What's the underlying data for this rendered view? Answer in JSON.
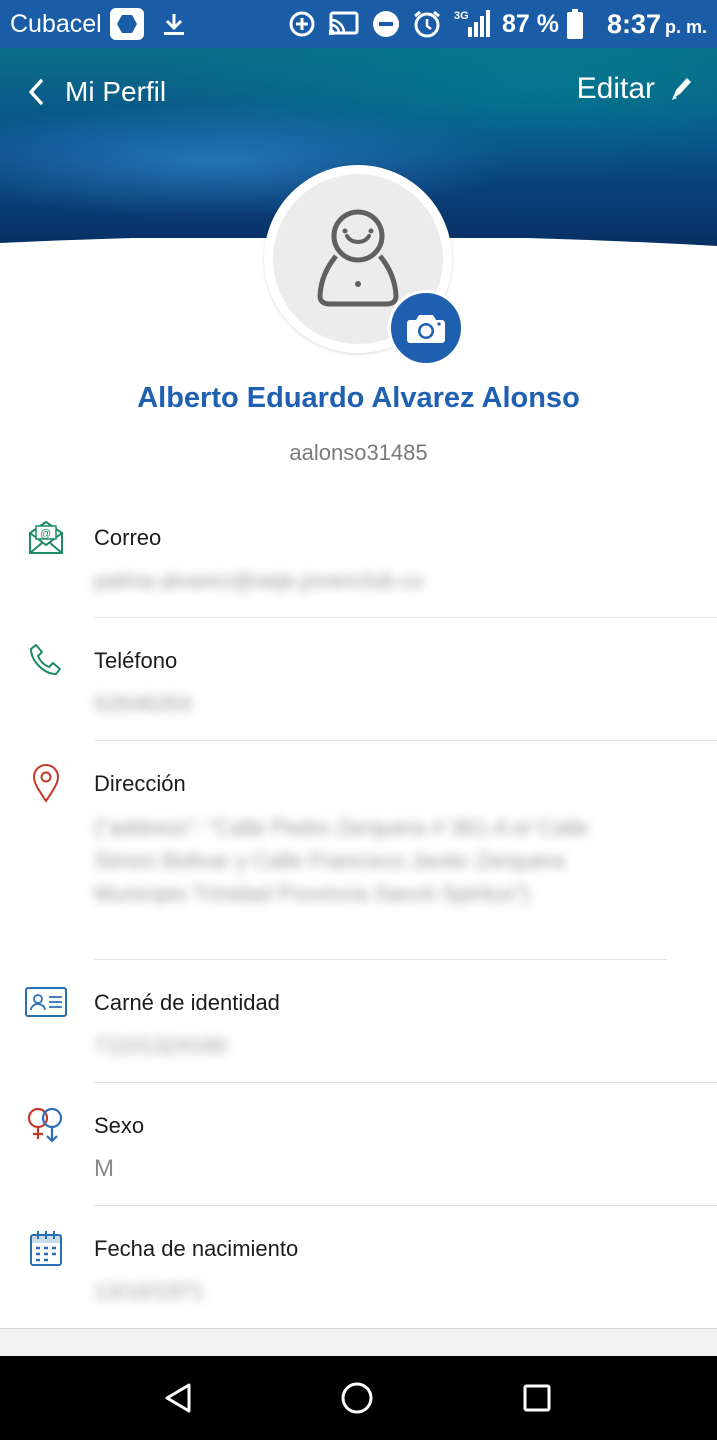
{
  "status_bar": {
    "carrier": "Cubacel",
    "network": "3G",
    "battery": "87 %",
    "time": "8:37",
    "ampm": "p. m."
  },
  "header": {
    "title": "Mi Perfil",
    "edit_label": "Editar"
  },
  "profile": {
    "name": "Alberto Eduardo Alvarez Alonso",
    "username": "aalonso31485"
  },
  "fields": {
    "email": {
      "label": "Correo",
      "value": "palma.alvarez@oeje.jovenclub.cu",
      "icon": "email-icon"
    },
    "phone": {
      "label": "Teléfono",
      "value": "52646264",
      "icon": "phone-icon"
    },
    "address": {
      "label": "Dirección",
      "value": "{\"address\": \"Calle Pedro Zerquera  # 361-A e/ Calle Simon Bolivar y Calle Francisco Javier Zerquera Municipio Trinidad Provincia Sancti Spiritus\"}",
      "icon": "location-pin-icon"
    },
    "id_card": {
      "label": "Carné de identidad",
      "value": "71101324160",
      "icon": "id-card-icon"
    },
    "sex": {
      "label": "Sexo",
      "value": "M",
      "icon": "gender-icon"
    },
    "birthdate": {
      "label": "Fecha de nacimiento",
      "value": "13/10/1971",
      "icon": "calendar-icon"
    }
  },
  "colors": {
    "accent": "#2060b0",
    "camera_button": "#1f5fb0",
    "status_bar": "#1a5da6",
    "icon_green": "#1e8a6a",
    "icon_red": "#c0392b",
    "icon_blue": "#2a6fb5"
  }
}
